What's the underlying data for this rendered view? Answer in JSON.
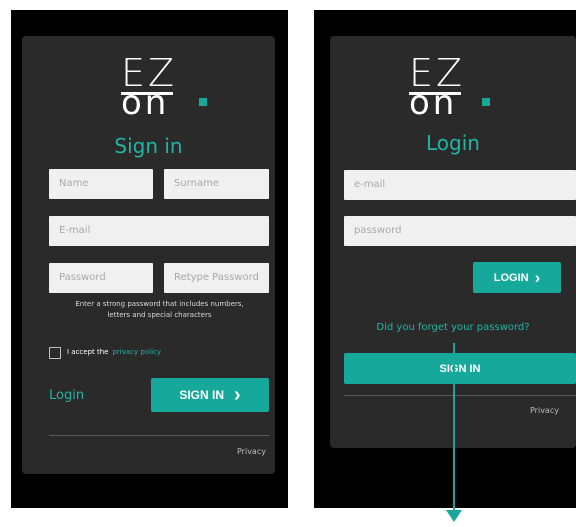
{
  "left_screen": {
    "logo": {
      "top": "EZ",
      "bottom": "on"
    },
    "title": "Sign in",
    "fields": {
      "name_placeholder": "Name",
      "surname_placeholder": "Surname",
      "email_placeholder": "E-mail",
      "password_placeholder": "Password",
      "retype_placeholder": "Retype Password"
    },
    "hint_line1": "Enter a strong password that includes numbers,",
    "hint_line2": "letters and special characters",
    "accept_text": "I accept the",
    "policy_link": "privacy policy",
    "login_link": "Login",
    "signin_button": "SIGN IN",
    "signin_chevron": "›",
    "privacy": "Privacy"
  },
  "right_screen": {
    "logo": {
      "top": "EZ",
      "bottom": "on"
    },
    "title": "Login",
    "fields": {
      "email_placeholder": "e-mail",
      "password_placeholder": "password"
    },
    "login_button": "LOGIN",
    "login_chevron": "›",
    "forgot_link": "Did you forget your password?",
    "signin_button": "SIGN IN",
    "privacy": "Privacy"
  },
  "colors": {
    "accent": "#16a89a",
    "panel": "#2a2a2a",
    "frame": "#000000",
    "input": "#f0f0f0"
  }
}
